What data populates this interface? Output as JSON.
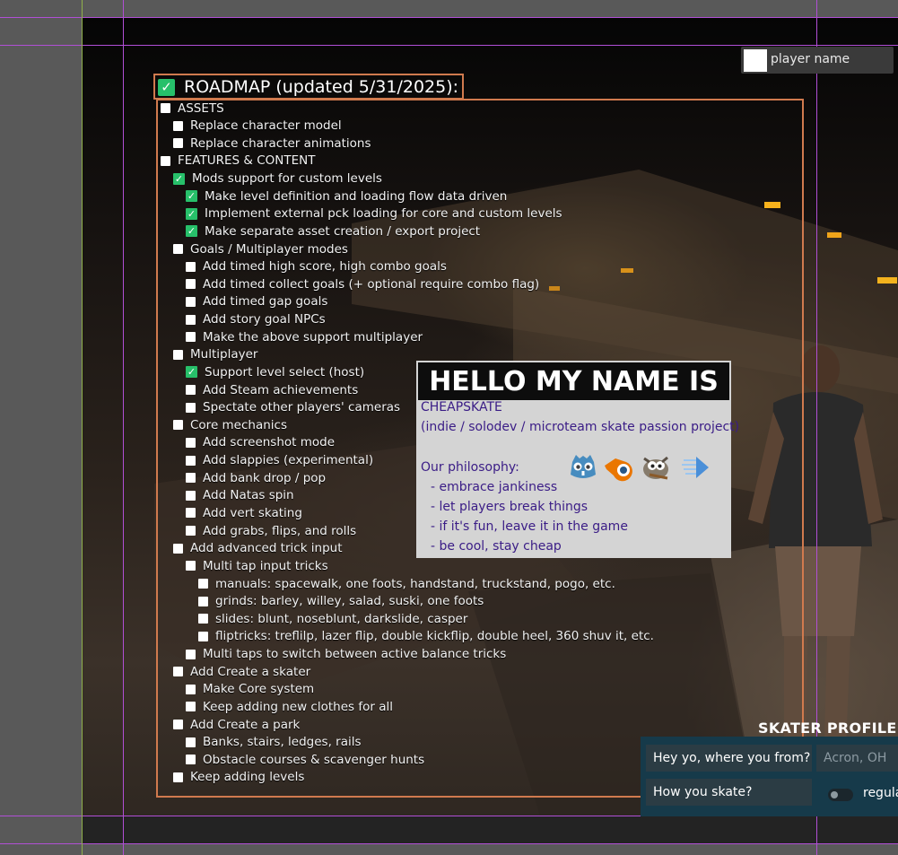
{
  "player": {
    "name_label": "player name"
  },
  "roadmap": {
    "title": "ROADMAP (updated 5/31/2025):",
    "title_checked": true,
    "items": [
      {
        "text": "ASSETS",
        "level": 0,
        "checked": false
      },
      {
        "text": "Replace character model",
        "level": 1,
        "checked": false
      },
      {
        "text": "Replace character animations",
        "level": 1,
        "checked": false
      },
      {
        "text": "FEATURES & CONTENT",
        "level": 0,
        "checked": false
      },
      {
        "text": "Mods support for custom levels",
        "level": 1,
        "checked": true
      },
      {
        "text": "Make level definition and loading flow data driven",
        "level": 2,
        "checked": true
      },
      {
        "text": "Implement external pck loading for core and custom levels",
        "level": 2,
        "checked": true
      },
      {
        "text": "Make separate asset creation / export project",
        "level": 2,
        "checked": true
      },
      {
        "text": "Goals / Multiplayer modes",
        "level": 1,
        "checked": false
      },
      {
        "text": "Add timed high score, high combo goals",
        "level": 2,
        "checked": false
      },
      {
        "text": "Add timed collect goals (+ optional require combo flag)",
        "level": 2,
        "checked": false
      },
      {
        "text": "Add timed gap goals",
        "level": 2,
        "checked": false
      },
      {
        "text": "Add story goal NPCs",
        "level": 2,
        "checked": false
      },
      {
        "text": "Make the above support multiplayer",
        "level": 2,
        "checked": false
      },
      {
        "text": "Multiplayer",
        "level": 1,
        "checked": false
      },
      {
        "text": "Support level select (host)",
        "level": 2,
        "checked": true
      },
      {
        "text": "Add Steam achievements",
        "level": 2,
        "checked": false
      },
      {
        "text": "Spectate other players' cameras",
        "level": 2,
        "checked": false
      },
      {
        "text": "Core mechanics",
        "level": 1,
        "checked": false
      },
      {
        "text": "Add screenshot mode",
        "level": 2,
        "checked": false
      },
      {
        "text": "Add slappies (experimental)",
        "level": 2,
        "checked": false
      },
      {
        "text": "Add bank drop / pop",
        "level": 2,
        "checked": false
      },
      {
        "text": "Add Natas spin",
        "level": 2,
        "checked": false
      },
      {
        "text": "Add vert skating",
        "level": 2,
        "checked": false
      },
      {
        "text": "Add grabs, flips, and rolls",
        "level": 2,
        "checked": false
      },
      {
        "text": "Add advanced trick input",
        "level": 1,
        "checked": false
      },
      {
        "text": "Multi tap input tricks",
        "level": 2,
        "checked": false
      },
      {
        "text": "manuals: spacewalk, one foots, handstand, truckstand, pogo, etc.",
        "level": 3,
        "checked": false
      },
      {
        "text": "grinds: barley, willey, salad, suski, one foots",
        "level": 3,
        "checked": false
      },
      {
        "text": "slides: blunt, noseblunt, darkslide, casper",
        "level": 3,
        "checked": false
      },
      {
        "text": "fliptricks: treflilp, lazer flip, double kickflip, double heel, 360 shuv it, etc.",
        "level": 3,
        "checked": false
      },
      {
        "text": "Multi taps to switch between active balance tricks",
        "level": 2,
        "checked": false
      },
      {
        "text": "Add Create a skater",
        "level": 1,
        "checked": false
      },
      {
        "text": "Make Core system",
        "level": 2,
        "checked": false
      },
      {
        "text": "Keep adding new clothes for all",
        "level": 2,
        "checked": false
      },
      {
        "text": "Add Create a park",
        "level": 1,
        "checked": false
      },
      {
        "text": "Banks, stairs, ledges, rails",
        "level": 2,
        "checked": false
      },
      {
        "text": "Obstacle courses & scavenger hunts",
        "level": 2,
        "checked": false
      },
      {
        "text": "Keep adding levels",
        "level": 1,
        "checked": false
      }
    ]
  },
  "nametag": {
    "header": "HELLO MY NAME IS",
    "name": "CHEAPSKATE",
    "tagline": "(indie / solodev / microteam skate passion project)",
    "philosophy_label": "Our philosophy:",
    "philosophy": [
      "- embrace jankiness",
      "- let players break things",
      "- if it's fun, leave it in the game",
      "- be cool, stay cheap"
    ],
    "logos": [
      "godot-logo-icon",
      "blender-logo-icon",
      "gimp-logo-icon",
      "aseprite-arrow-logo-icon"
    ]
  },
  "skater_profile": {
    "title": "SKATER PROFILE",
    "q_from": "Hey yo, where you from?",
    "from_placeholder": "Acron, OH",
    "q_stance": "How you skate?",
    "stance_label": "regula"
  },
  "colors": {
    "check_green": "#27c06a",
    "roadmap_border": "#d07a4e",
    "guide_purple": "#b14fd6",
    "nametag_text": "#3a1c86",
    "profile_panel": "#163a4a"
  }
}
